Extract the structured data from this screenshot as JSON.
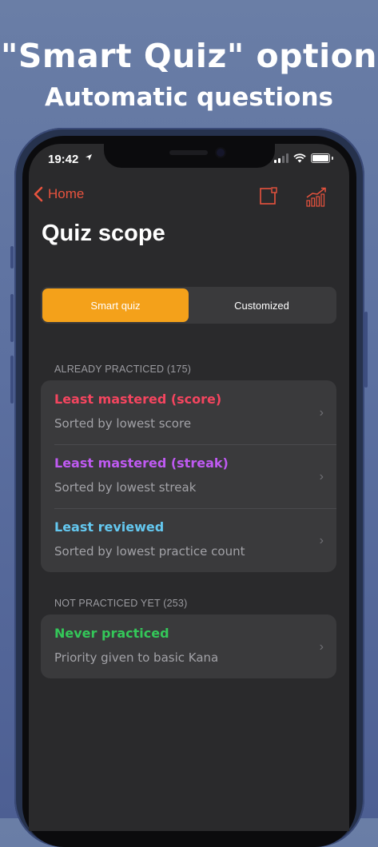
{
  "headline": {
    "line1": "\"Smart Quiz\" option",
    "line2": "Automatic questions"
  },
  "status_bar": {
    "time": "19:42",
    "location_icon": "location-arrow-icon",
    "icons": [
      "signal-icon",
      "wifi-icon",
      "battery-icon"
    ]
  },
  "nav": {
    "back_label": "Home",
    "back_icon": "chevron-left-icon",
    "right_icons": [
      "notepad-icon",
      "stats-chart-icon"
    ],
    "accent": "#e8533e"
  },
  "page_title": "Quiz scope",
  "segmented": {
    "options": [
      "Smart quiz",
      "Customized"
    ],
    "selected": "Smart quiz",
    "active_color": "#f4a11a"
  },
  "sections": [
    {
      "header": "ALREADY PRACTICED (175)",
      "rows": [
        {
          "title": "Least mastered (score)",
          "subtitle": "Sorted by lowest score",
          "color": "#f4455f"
        },
        {
          "title": "Least mastered (streak)",
          "subtitle": "Sorted by lowest streak",
          "color": "#bf5af2"
        },
        {
          "title": "Least reviewed",
          "subtitle": "Sorted by lowest practice count",
          "color": "#64c8f0"
        }
      ]
    },
    {
      "header": "NOT PRACTICED YET (253)",
      "rows": [
        {
          "title": "Never practiced",
          "subtitle": "Priority given to basic Kana",
          "color": "#34c759"
        }
      ]
    }
  ]
}
